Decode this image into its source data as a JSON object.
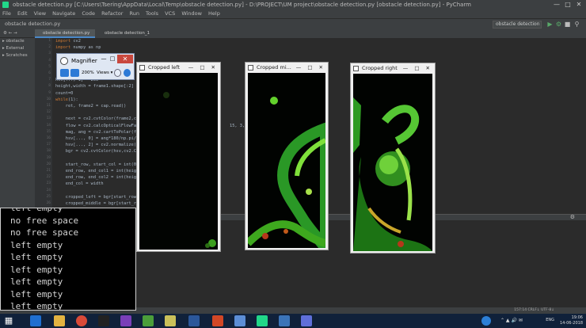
{
  "titlebar": {
    "title": "obstacle detection.py [C:\\Users\\Tsering\\AppData\\Local\\Temp\\obstacle detection.py] - D:\\PROJECT\\UM project\\obstacle detection.py [obstacle detection.py] - PyCharm",
    "minimize": "—",
    "maximize": "□",
    "close": "✕"
  },
  "menubar": [
    "File",
    "Edit",
    "View",
    "Navigate",
    "Code",
    "Refactor",
    "Run",
    "Tools",
    "VCS",
    "Window",
    "Help"
  ],
  "navbar": {
    "breadcrumb": "obstacle detection.py",
    "run_config": "obstacle detection"
  },
  "project_panel": {
    "header": "⚙ ← →",
    "items": [
      "▸ obstacle",
      "▸ External",
      "▸ Scratches"
    ]
  },
  "tabs": [
    "obstacle detection.py",
    "obstacle detection_1"
  ],
  "editor": {
    "lines": [
      {
        "n": "1",
        "text": "import cv2"
      },
      {
        "n": "2",
        "text": "import numpy as np"
      },
      {
        "n": "3",
        "text": ""
      },
      {
        "n": "4",
        "text": ""
      },
      {
        "n": "5",
        "text": ""
      },
      {
        "n": "6",
        "text": ""
      },
      {
        "n": "7",
        "text": "hsv[..., 1] = 255"
      },
      {
        "n": "8",
        "text": "height,width = frame1.shape[:2]"
      },
      {
        "n": "9",
        "text": "count=0"
      },
      {
        "n": "10",
        "text": "while(1):"
      },
      {
        "n": "11",
        "text": "    ret, frame2 = cap.read()"
      },
      {
        "n": "12",
        "text": ""
      },
      {
        "n": "13",
        "text": "    next = cv2.cvtColor(frame2,c"
      },
      {
        "n": "14",
        "text": "    flow = cv2.calcOpticalFlowFa                                     15, 3, 5,"
      },
      {
        "n": "15",
        "text": "    mag, ang = cv2.cartToPolar(fl"
      },
      {
        "n": "16",
        "text": "    hsv[..., 0] = ang*180/np.pi/"
      },
      {
        "n": "17",
        "text": "    hsv[..., 2] = cv2.normalize(m"
      },
      {
        "n": "18",
        "text": "    bgr = cv2.cvtColor(hsv,cv2.CO"
      },
      {
        "n": "19",
        "text": ""
      },
      {
        "n": "20",
        "text": "    start_row, start_col = int(0)"
      },
      {
        "n": "21",
        "text": "    end_row, end_col1 = int(heig"
      },
      {
        "n": "22",
        "text": "    end_row, end_col2 = int(heig"
      },
      {
        "n": "23",
        "text": "    end_col = width"
      },
      {
        "n": "24",
        "text": ""
      },
      {
        "n": "25",
        "text": "    cropped_left = bgr[start_row"
      },
      {
        "n": "26",
        "text": "    cropped_middle = bgr[start_r"
      }
    ]
  },
  "console": {
    "lines": [
      "left empty",
      "no free space",
      "no free space",
      "left empty",
      "left empty",
      "left empty",
      "left empty",
      "left empty",
      "left empty"
    ]
  },
  "magnifier": {
    "title": "Magnifier",
    "zoom": "200%",
    "views_label": "Views ▾",
    "min": "—",
    "max": "□",
    "close": "✕"
  },
  "windows": {
    "left": {
      "title": "Cropped left"
    },
    "middle": {
      "title": "Cropped mi..."
    },
    "right": {
      "title": "Cropped right"
    },
    "controls": "— □ ✕"
  },
  "statusbar": {
    "text": "157:14   CRLF↓   UTF-8↓"
  },
  "taskbar": {
    "language": "ENG",
    "time": "19:06",
    "date": "14-06-2018"
  },
  "colors": {
    "ide_dark": "#2b2b2b",
    "ide_panel": "#3c3f41",
    "console_bg": "#000000",
    "flow_green": "#3fd22a",
    "taskbar": "#10213a"
  }
}
